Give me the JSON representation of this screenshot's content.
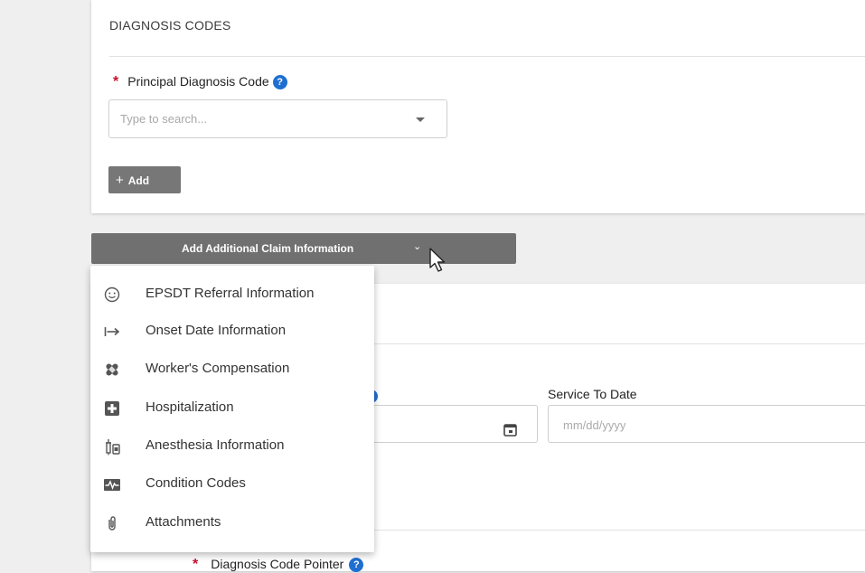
{
  "diagnosis": {
    "section_title": "DIAGNOSIS CODES",
    "principal_label": "Principal Diagnosis Code",
    "required_mark": "*",
    "help_glyph": "?",
    "search_placeholder": "Type to search...",
    "add_label": "Add"
  },
  "additional": {
    "button_label": "Add Additional Claim Information",
    "chevron": "⌄"
  },
  "menu": {
    "items": [
      {
        "label": "EPSDT Referral Information",
        "icon": "smiley-icon"
      },
      {
        "label": "Onset Date Information",
        "icon": "arrow-to-right-icon"
      },
      {
        "label": "Worker's Compensation",
        "icon": "bandage-icon"
      },
      {
        "label": "Hospitalization",
        "icon": "hospital-plus-icon"
      },
      {
        "label": "Anesthesia Information",
        "icon": "syringe-icon"
      },
      {
        "label": "Condition Codes",
        "icon": "pulse-icon"
      },
      {
        "label": "Attachments",
        "icon": "paperclip-icon"
      }
    ]
  },
  "service": {
    "to_label": "Service To Date",
    "to_placeholder": "mm/dd/yyyy"
  },
  "pointer": {
    "label": "Diagnosis Code Pointer"
  },
  "colors": {
    "required": "#c8102e",
    "help": "#1f6fd1",
    "button_gray": "#707070"
  }
}
